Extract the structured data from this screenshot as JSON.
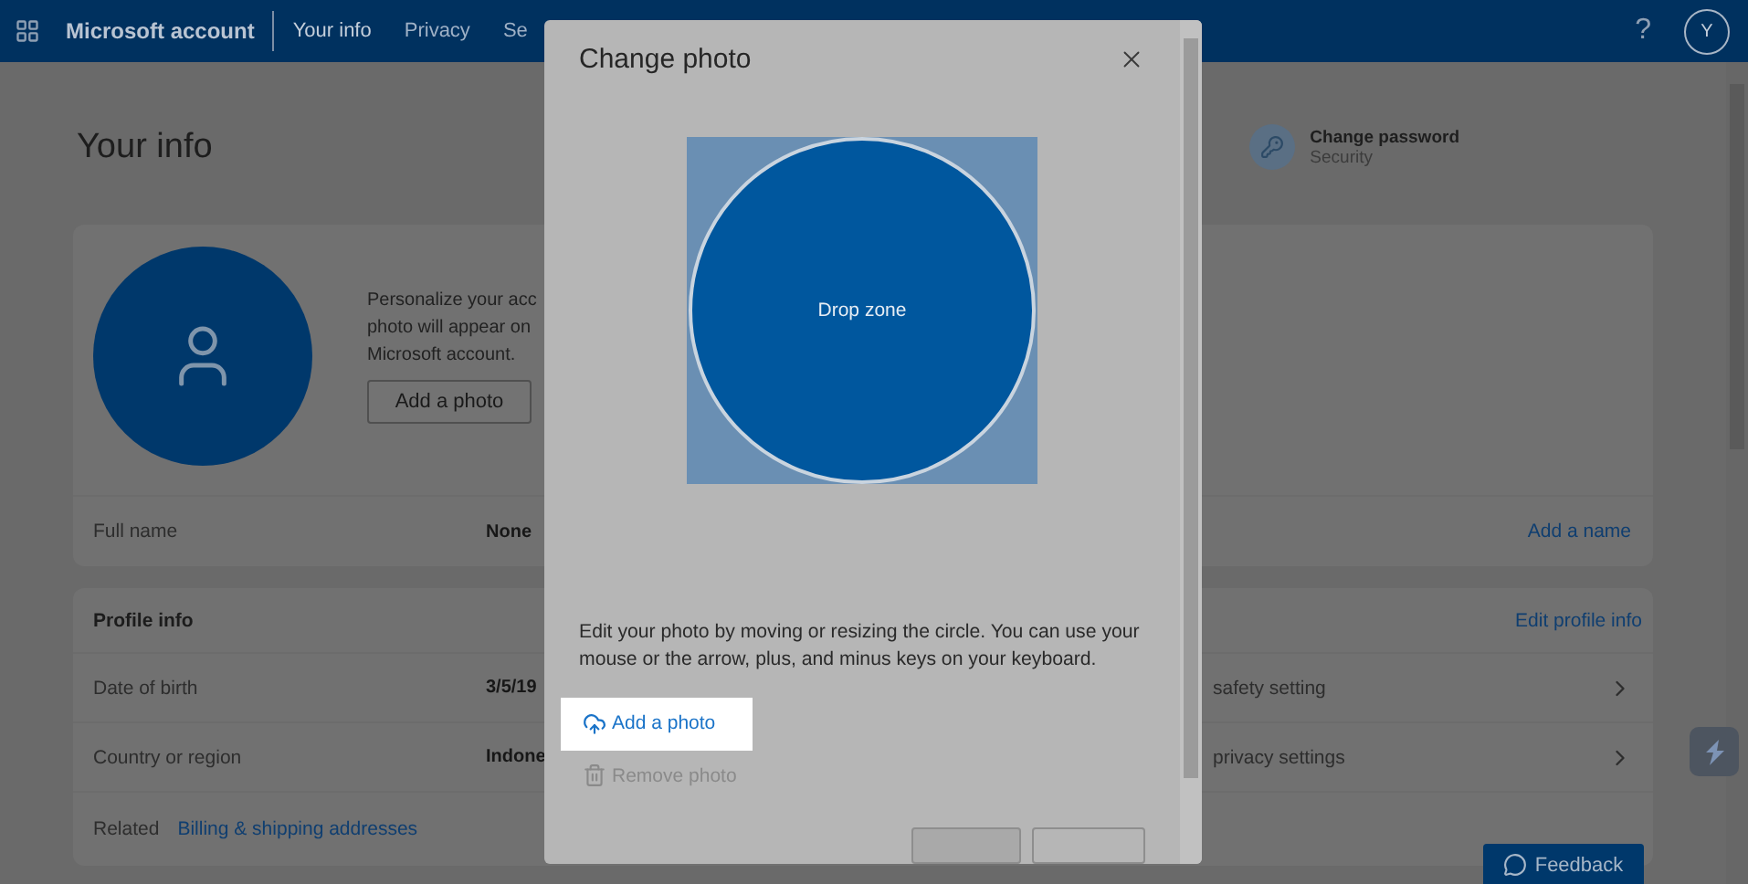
{
  "top_bar": {
    "brand": "Microsoft account",
    "nav": [
      {
        "label": "Your info",
        "selected": true
      },
      {
        "label": "Privacy",
        "selected": false
      },
      {
        "label": "Se",
        "selected": false
      }
    ],
    "help": "?",
    "avatar_initial": "Y"
  },
  "page_title": "Your info",
  "security_link": {
    "title": "Change password",
    "subtitle": "Security"
  },
  "photo_card": {
    "text_lines": [
      "Personalize your acc",
      "photo will appear on",
      "Microsoft account."
    ],
    "button": "Add a photo",
    "row": {
      "label": "Full name",
      "value": "None",
      "action": "Add a name"
    }
  },
  "profile_card": {
    "title": "Profile info",
    "action": "Edit profile info",
    "rows": [
      {
        "label": "Date of birth",
        "value": "3/5/19",
        "right_text": "safety setting"
      },
      {
        "label": "Country or region",
        "value": "Indone",
        "right_text": "privacy settings"
      }
    ],
    "related_label": "Related",
    "related_link": "Billing & shipping addresses"
  },
  "feedback_button": "Feedback",
  "dialog": {
    "title": "Change photo",
    "drop_zone": "Drop zone",
    "instructions": "Edit your photo by moving or resizing the circle. You can use your mouse or the arrow, plus, and minus keys on your keyboard.",
    "actions": [
      {
        "label": "Add a photo",
        "kind": "upload",
        "disabled": false,
        "selected": true
      },
      {
        "label": "Remove photo",
        "kind": "remove",
        "disabled": true,
        "selected": false
      }
    ]
  }
}
